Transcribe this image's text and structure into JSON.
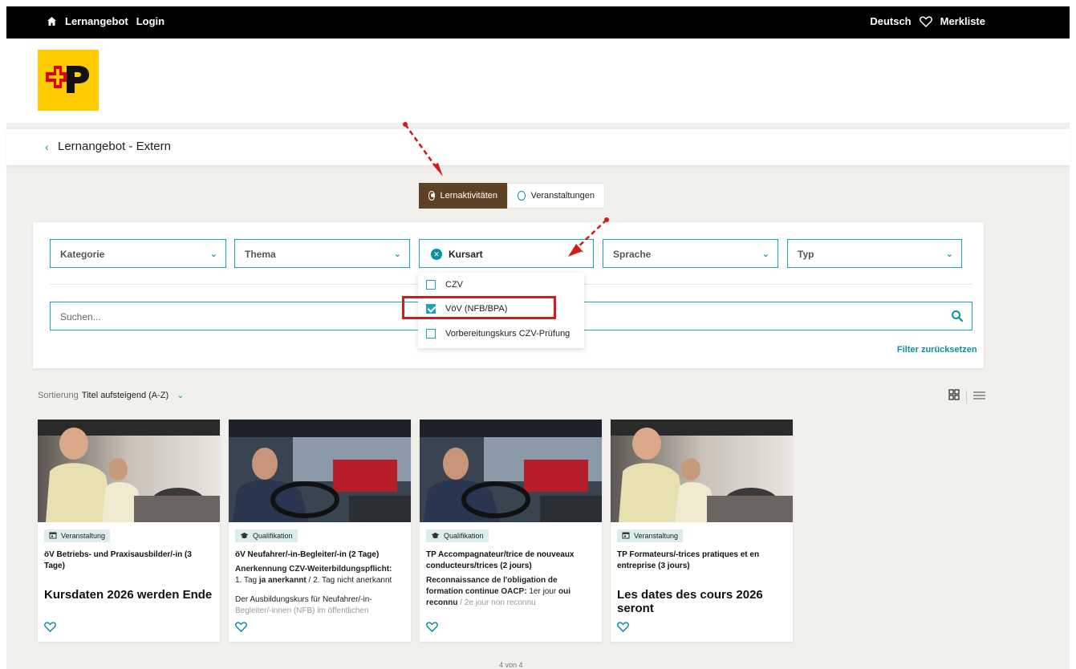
{
  "topbar": {
    "home_label": "Lernangebot",
    "login_label": "Login",
    "language": "Deutsch",
    "watchlist": "Merkliste"
  },
  "breadcrumb": {
    "title": "Lernangebot - Extern"
  },
  "toggle": {
    "active": "Lernaktivitäten",
    "inactive": "Veranstaltungen"
  },
  "filters": {
    "kategorie": "Kategorie",
    "thema": "Thema",
    "kursart": "Kursart",
    "sprache": "Sprache",
    "typ": "Typ"
  },
  "dropdown": {
    "options": [
      {
        "label": "CZV",
        "checked": false
      },
      {
        "label": "VöV (NFB/BPA)",
        "checked": true
      },
      {
        "label": "Vorbereitungskurs CZV-Prüfung",
        "checked": false
      }
    ]
  },
  "search": {
    "placeholder": "Suchen..."
  },
  "reset_label": "Filter zurücksetzen",
  "sort": {
    "label": "Sortierung",
    "value": "Titel aufsteigend (A-Z)"
  },
  "cards": [
    {
      "badge": "Veranstaltung",
      "title": "öV Betriebs- und Praxisausbilder/-in (3 Tage)",
      "big": "Kursdaten 2026 werden Ende"
    },
    {
      "badge": "Qualifikation",
      "title": "öV Neufahrer/-in-Begleiter/-in (2 Tage)",
      "body_bold": "Anerkennung CZV-Weiterbildungspflicht:",
      "body_line1_pre": "1. Tag ",
      "body_line1_bold": "ja anerkannt",
      "body_line1_post": " / 2. Tag nicht anerkannt",
      "body_para": "Der Ausbildungskurs für Neufahrer/-in-",
      "body_fade": "Begleiter/-innen (NFB) im öffentlichen"
    },
    {
      "badge": "Qualifikation",
      "title": "TP Accompagnateur/trice de nouveaux conducteurs/trices (2 jours)",
      "body_bold": "Reconnaissance de l'obligation de formation continue OACP:",
      "body_mid": " 1er jour ",
      "body_bold2": "oui reconnu",
      "body_end": " / 2e jour non reconnu"
    },
    {
      "badge": "Veranstaltung",
      "title": "TP Formateurs/-trices pratiques et en entreprise (3 jours)",
      "big": "Les dates des cours 2026 seront"
    }
  ],
  "pager": "4 von 4",
  "colors": {
    "accent": "#0b8fa8",
    "brand_yellow": "#ffcc00",
    "active_toggle": "#5e4024",
    "highlight": "#d61a1a"
  }
}
